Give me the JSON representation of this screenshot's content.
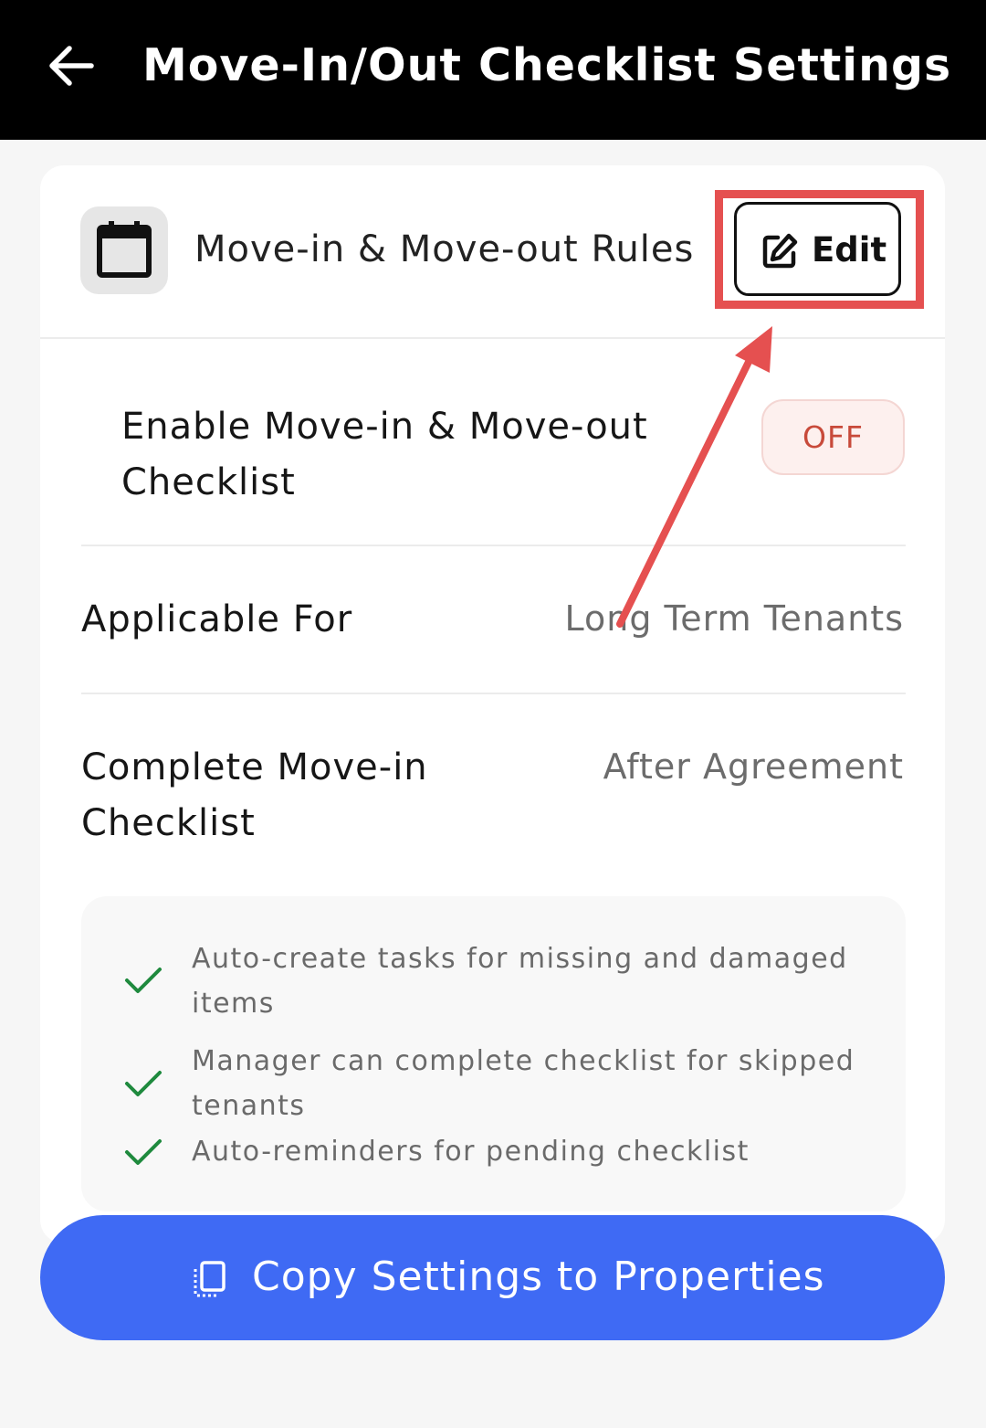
{
  "header": {
    "title": "Move-In/Out Checklist Settings",
    "back_icon": "arrow-left-icon"
  },
  "rules_card": {
    "icon": "calendar-icon",
    "title": "Move-in & Move-out Rules",
    "edit_label": "Edit",
    "edit_icon": "edit-icon"
  },
  "settings": {
    "enable_label": "Enable Move-in & Move-out Checklist",
    "enable_value": "OFF",
    "applicable_label": "Applicable For",
    "applicable_value": "Long Term Tenants",
    "complete_label": "Complete Move-in Checklist",
    "complete_value": "After Agreement"
  },
  "features": [
    "Auto-create tasks for missing and damaged items",
    "Manager can complete checklist for skipped tenants",
    "Auto-reminders for pending checklist"
  ],
  "copy_button": {
    "label": "Copy Settings to Properties",
    "icon": "copy-icon"
  },
  "colors": {
    "header_bg": "#000000",
    "primary_button": "#3f6af4",
    "off_text": "#c84a3a",
    "check": "#1f8a3e",
    "annotation": "#e55050"
  }
}
